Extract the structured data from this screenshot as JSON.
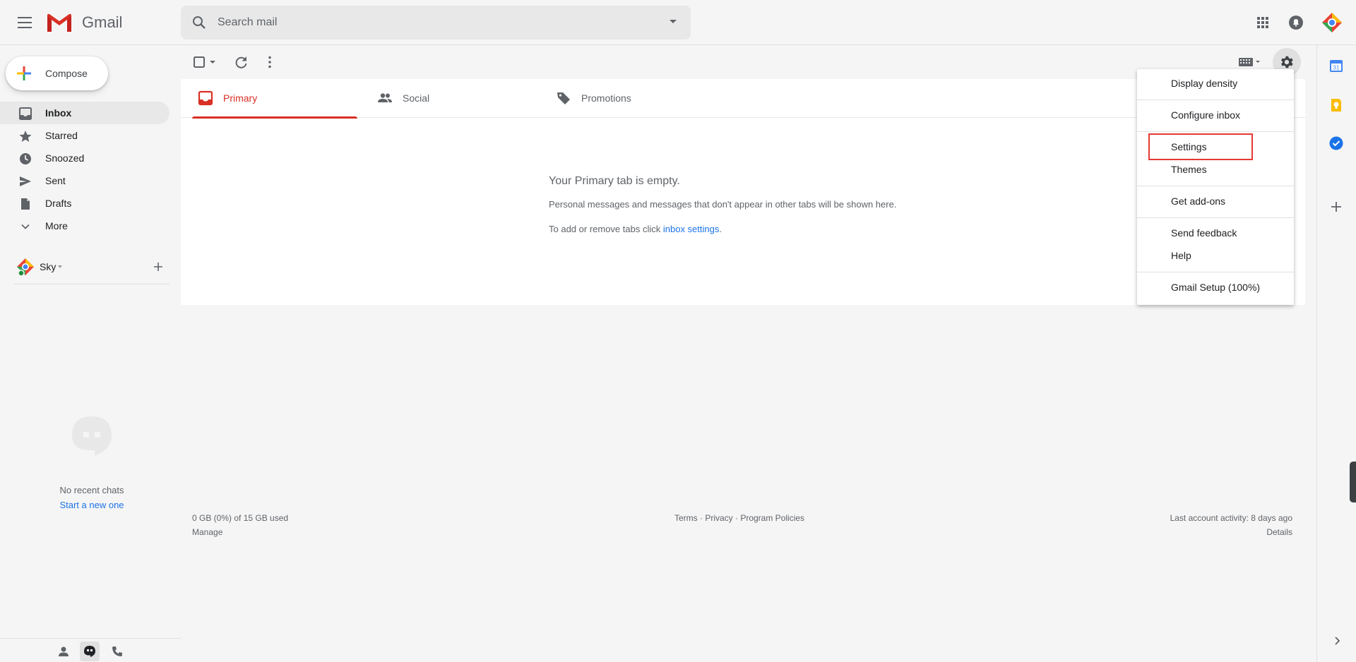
{
  "header": {
    "app_name": "Gmail",
    "search_placeholder": "Search mail",
    "icons": [
      "menu-icon",
      "gmail-logo",
      "search-icon",
      "apps-grid-icon",
      "notifications-icon",
      "account-avatar"
    ]
  },
  "sidebar": {
    "compose_label": "Compose",
    "items": [
      {
        "label": "Inbox",
        "icon": "inbox-icon",
        "active": true
      },
      {
        "label": "Starred",
        "icon": "star-icon"
      },
      {
        "label": "Snoozed",
        "icon": "clock-icon"
      },
      {
        "label": "Sent",
        "icon": "send-icon"
      },
      {
        "label": "Drafts",
        "icon": "draft-icon"
      },
      {
        "label": "More",
        "icon": "chevron-down-icon"
      }
    ],
    "account_name": "Sky",
    "no_chats": "No recent chats",
    "start_new": "Start a new one"
  },
  "tabs": [
    {
      "label": "Primary",
      "icon": "inbox-tab-icon",
      "active": true
    },
    {
      "label": "Social",
      "icon": "people-icon"
    },
    {
      "label": "Promotions",
      "icon": "tag-icon"
    }
  ],
  "empty": {
    "title": "Your Primary tab is empty.",
    "description": "Personal messages and messages that don't appear in other tabs will be shown here.",
    "add_prefix": "To add or remove tabs click ",
    "add_link": "inbox settings",
    "add_suffix": "."
  },
  "footer": {
    "storage": "0 GB (0%) of 15 GB used",
    "manage": "Manage",
    "links": "Terms · Privacy · Program Policies",
    "activity": "Last account activity: 8 days ago",
    "details": "Details"
  },
  "settings_menu": {
    "items": [
      "Display density",
      "Configure inbox",
      "Settings",
      "Themes",
      "Get add-ons",
      "Send feedback",
      "Help",
      "Gmail Setup (100%)"
    ],
    "highlighted": "Settings"
  },
  "colors": {
    "accent_red": "#d93025",
    "link_blue": "#1a73e8",
    "highlight_red": "#e53935"
  }
}
